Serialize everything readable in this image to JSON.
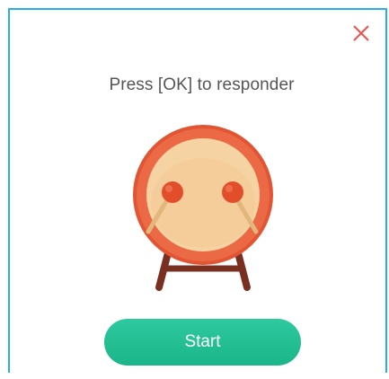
{
  "dialog": {
    "title": "Press [OK] to responder",
    "start_label": "Start",
    "close_icon": "close-icon",
    "illustration_icon": "drum-icon"
  },
  "colors": {
    "border": "#29aee6",
    "close": "#e9554c",
    "button": "#1dbd90",
    "drum_rim": "#e15534",
    "drum_face": "#f6d3a3",
    "drum_stand": "#7a3020"
  }
}
